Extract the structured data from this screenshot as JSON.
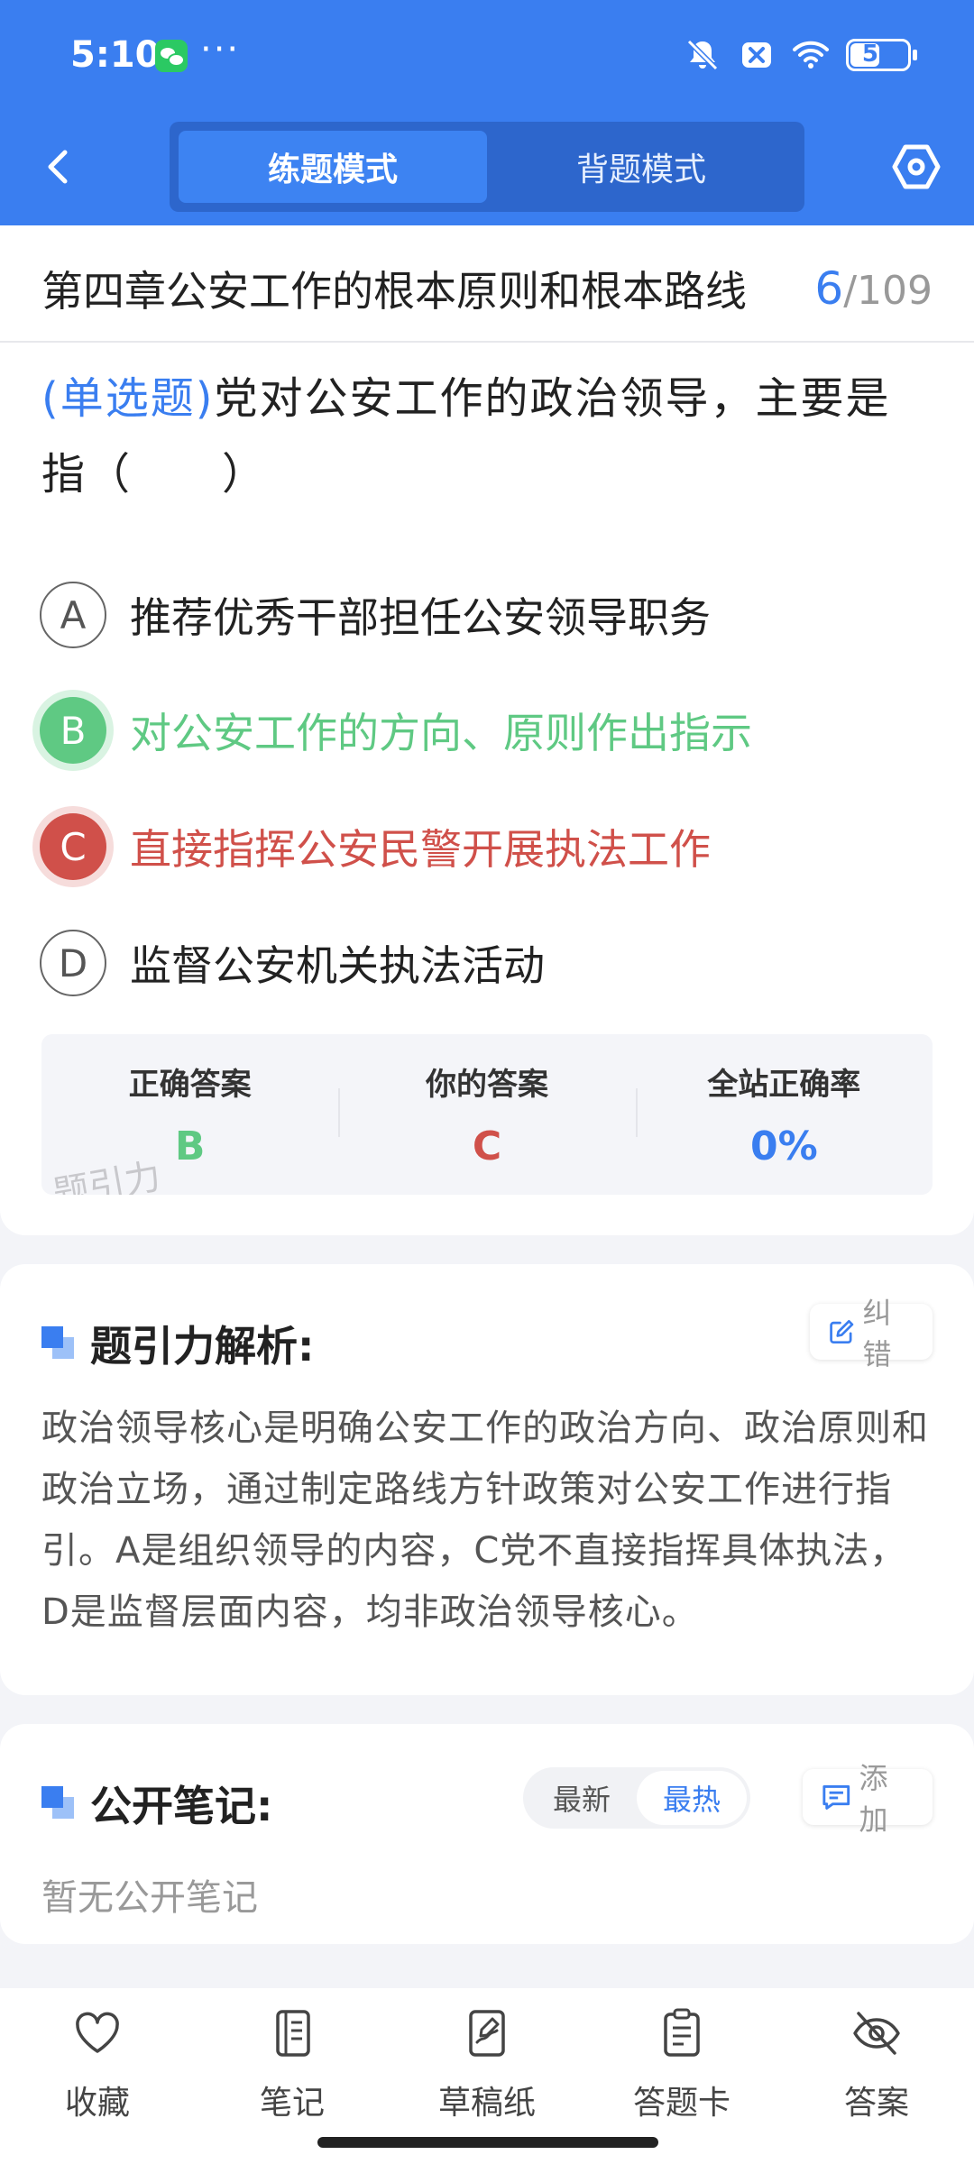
{
  "status_bar": {
    "time": "5:10",
    "dots": "···",
    "battery": "54",
    "battery_level": 0.54
  },
  "nav": {
    "tabs": [
      {
        "label": "练题模式",
        "active": true
      },
      {
        "label": "背题模式",
        "active": false
      }
    ]
  },
  "question": {
    "chapter": "第四章公安工作的根本原则和根本路线",
    "current": "6",
    "total": "/109",
    "type": "(单选题)",
    "text": "党对公安工作的政治领导，主要是指（　　）",
    "options": [
      {
        "letter": "A",
        "text": "推荐优秀干部担任公安领导职务",
        "state": "normal"
      },
      {
        "letter": "B",
        "text": "对公安工作的方向、原则作出指示",
        "state": "correct"
      },
      {
        "letter": "C",
        "text": "直接指挥公安民警开展执法工作",
        "state": "wrong"
      },
      {
        "letter": "D",
        "text": "监督公安机关执法活动",
        "state": "normal"
      }
    ]
  },
  "answers": {
    "correct_label": "正确答案",
    "correct_value": "B",
    "yours_label": "你的答案",
    "yours_value": "C",
    "rate_label": "全站正确率",
    "rate_value": "0%",
    "watermark": "题引力"
  },
  "analysis": {
    "title": "题引力解析:",
    "report_label": "纠错",
    "body": "政治领导核心是明确公安工作的政治方向、政治原则和政治立场，通过制定路线方针政策对公安工作进行指引。A是组织领导的内容，C党不直接指挥具体执法，D是监督层面内容，均非政治领导核心。"
  },
  "notes": {
    "title": "公开笔记:",
    "sort_latest": "最新",
    "sort_hot": "最热",
    "add_label": "添加",
    "empty": "暂无公开笔记"
  },
  "bottom_bar": {
    "items": [
      {
        "label": "收藏",
        "icon": "heart-icon"
      },
      {
        "label": "笔记",
        "icon": "notebook-icon"
      },
      {
        "label": "草稿纸",
        "icon": "draft-icon"
      },
      {
        "label": "答题卡",
        "icon": "answer-card-icon"
      },
      {
        "label": "答案",
        "icon": "eye-off-icon"
      }
    ]
  },
  "colors": {
    "brand": "#3a7ef0",
    "correct": "#5fc983",
    "wrong": "#d0504a"
  }
}
